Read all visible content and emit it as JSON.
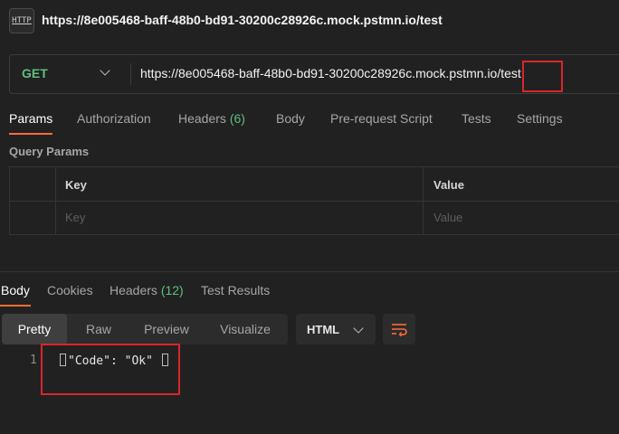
{
  "app": {
    "icon_label": "HTTP",
    "title": "https://8e005468-baff-48b0-bd91-30200c28926c.mock.pstmn.io/test"
  },
  "request": {
    "method": "GET",
    "url_base": "https://8e005468-baff-48b0-bd91-30200c28926c.mock.pstmn.io",
    "url_path": "/test"
  },
  "request_tabs": {
    "params": "Params",
    "authorization": "Authorization",
    "headers": "Headers",
    "headers_count": "(6)",
    "body": "Body",
    "pre_request": "Pre-request Script",
    "tests": "Tests",
    "settings": "Settings"
  },
  "query_params": {
    "title": "Query Params",
    "col_key": "Key",
    "col_value": "Value",
    "key_placeholder": "Key",
    "value_placeholder": "Value"
  },
  "response_tabs": {
    "body": "Body",
    "cookies": "Cookies",
    "headers": "Headers",
    "headers_count": "(12)",
    "test_results": "Test Results"
  },
  "format": {
    "pretty": "Pretty",
    "raw": "Raw",
    "preview": "Preview",
    "visualize": "Visualize",
    "language": "HTML"
  },
  "response_body": {
    "line_number": "1",
    "code": "\"Code\": \"Ok\""
  },
  "colors": {
    "accent": "#ff6c37",
    "method_green": "#5fbf7f",
    "highlight_red": "#d9262c"
  }
}
